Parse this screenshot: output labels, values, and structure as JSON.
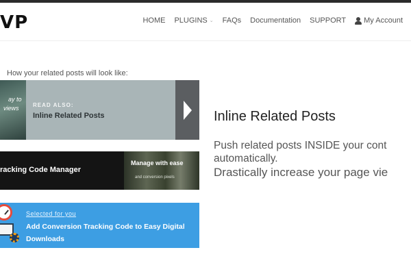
{
  "header": {
    "logo_text": "VP",
    "nav": [
      {
        "label": "HOME"
      },
      {
        "label": "PLUGINS",
        "has_dropdown": true,
        "caret": "⌄"
      },
      {
        "label": "FAQs"
      },
      {
        "label": "Documentation"
      },
      {
        "label": "SUPPORT"
      },
      {
        "label": "My Account",
        "icon": "user-icon"
      }
    ]
  },
  "preview": {
    "caption": "How your related posts will look like:",
    "banner1": {
      "thumb_text_line1": "ay to",
      "thumb_text_line2": "views",
      "eyebrow": "READ ALSO:",
      "title": "Inline Related Posts",
      "arrow_icon": "chevron-right-icon",
      "bg_color": "#a9b5b7",
      "arrow_bg_color": "#5b5e61"
    },
    "banner2": {
      "title": "racking Code Manager",
      "thumb_title": "Manage with ease",
      "thumb_subtitle": "and conversion pixels",
      "bg_color": "#141414"
    },
    "banner3": {
      "eyebrow": "Selected for you",
      "title": "Add Conversion Tracking Code to Easy Digital Downloads",
      "bg_color": "#3d9ee3"
    }
  },
  "hero": {
    "title": "Inline Related Posts",
    "line1": "Push related posts INSIDE your cont",
    "line2": "automatically.",
    "line3": "Drastically increase your page vie"
  }
}
